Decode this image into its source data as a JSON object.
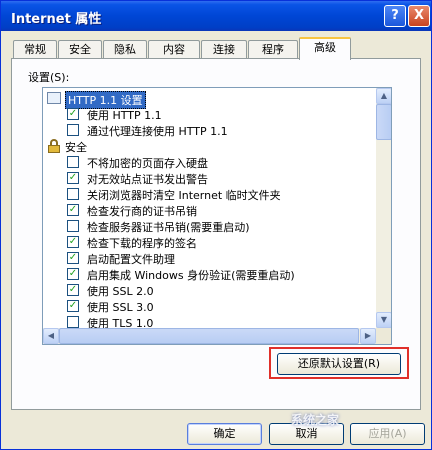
{
  "window": {
    "title": "Internet 属性"
  },
  "titlebar_buttons": {
    "help": "?",
    "close": "X"
  },
  "tabs": [
    {
      "label": "常规"
    },
    {
      "label": "安全"
    },
    {
      "label": "隐私"
    },
    {
      "label": "内容"
    },
    {
      "label": "连接"
    },
    {
      "label": "程序"
    },
    {
      "label": "高级",
      "active": true
    }
  ],
  "panel": {
    "settings_label": "设置(S):"
  },
  "list": [
    {
      "type": "heading",
      "icon": "folder-icon",
      "text": "HTTP 1.1 设置"
    },
    {
      "type": "checkbox",
      "checked": true,
      "text": "使用 HTTP 1.1"
    },
    {
      "type": "checkbox",
      "checked": false,
      "text": "通过代理连接使用 HTTP 1.1"
    },
    {
      "type": "heading",
      "icon": "lock-icon",
      "text": "安全"
    },
    {
      "type": "checkbox",
      "checked": false,
      "text": "不将加密的页面存入硬盘"
    },
    {
      "type": "checkbox",
      "checked": true,
      "text": "对无效站点证书发出警告"
    },
    {
      "type": "checkbox",
      "checked": false,
      "text": "关闭浏览器时清空 Internet 临时文件夹"
    },
    {
      "type": "checkbox",
      "checked": true,
      "text": "检查发行商的证书吊销"
    },
    {
      "type": "checkbox",
      "checked": false,
      "text": "检查服务器证书吊销(需要重启动)"
    },
    {
      "type": "checkbox",
      "checked": true,
      "text": "检查下载的程序的签名"
    },
    {
      "type": "checkbox",
      "checked": true,
      "text": "启动配置文件助理"
    },
    {
      "type": "checkbox",
      "checked": true,
      "text": "启用集成 Windows 身份验证(需要重启动)"
    },
    {
      "type": "checkbox",
      "checked": true,
      "text": "使用 SSL 2.0"
    },
    {
      "type": "checkbox",
      "checked": true,
      "text": "使用 SSL 3.0"
    },
    {
      "type": "checkbox",
      "checked": false,
      "text": "使用 TLS 1.0"
    }
  ],
  "buttons": {
    "restore_defaults": "还原默认设置(R)",
    "ok": "确定",
    "cancel": "取消",
    "apply": "应用(A)"
  },
  "watermark": "系统之家",
  "colors": {
    "title_bar": "#0046d5",
    "highlight_box": "#e0302a",
    "panel": "#ece9d8"
  }
}
